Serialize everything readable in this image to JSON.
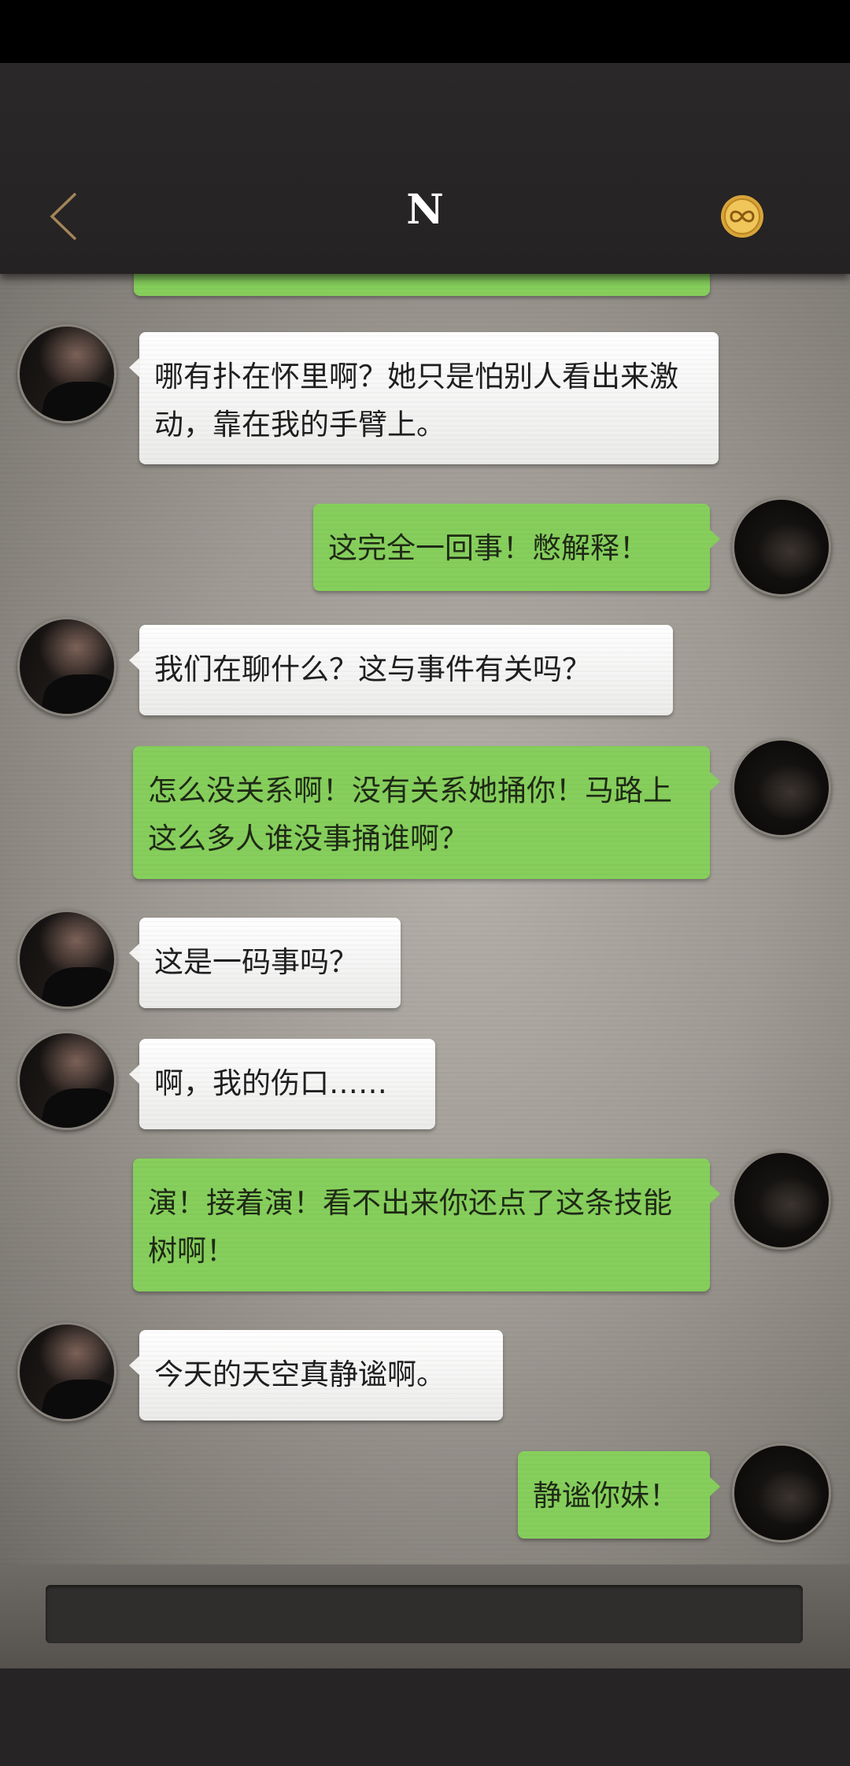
{
  "header": {
    "title": "N",
    "back_icon": "chevron-left-icon",
    "badge_icon": "infinity-coin-icon",
    "accent": "#a3855a"
  },
  "messages": [
    {
      "side": "right",
      "text": ""
    },
    {
      "side": "left",
      "text": "哪有扑在怀里啊？她只是怕别人看出来激动，靠在我的手臂上。"
    },
    {
      "side": "right",
      "text": "这完全一回事！憋解释！"
    },
    {
      "side": "left",
      "text": "我们在聊什么？这与事件有关吗？"
    },
    {
      "side": "right",
      "text": "怎么没关系啊！没有关系她捅你！马路上这么多人谁没事捅谁啊？"
    },
    {
      "side": "left",
      "text": "这是一码事吗？"
    },
    {
      "side": "left",
      "text": "啊，我的伤口……"
    },
    {
      "side": "right",
      "text": "演！接着演！看不出来你还点了这条技能树啊！"
    },
    {
      "side": "left",
      "text": "今天的天空真静谧啊。"
    },
    {
      "side": "right",
      "text": "静谧你妹！"
    }
  ],
  "input": {
    "placeholder": ""
  },
  "colors": {
    "incoming_bubble": "#ffffff",
    "outgoing_bubble": "#86cf5c"
  }
}
